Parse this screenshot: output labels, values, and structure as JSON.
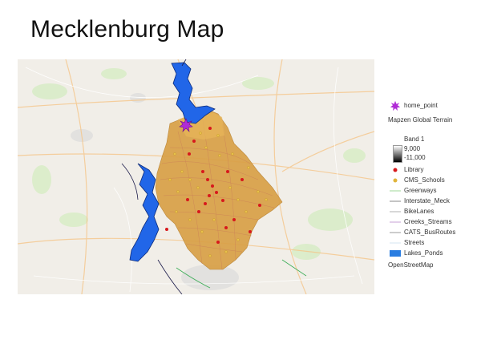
{
  "title": "Mecklenburg Map",
  "map": {
    "colors": {
      "county_fill": "#d9a047",
      "water": "#2166e8",
      "library": "#d7191c",
      "school": "#e0b43a",
      "home": "#9c27b0",
      "basemap": "#f2efe9"
    }
  },
  "legend": {
    "items": [
      {
        "key": "home_point",
        "label": "home_point",
        "symbol": "star",
        "color": "#b02bd6"
      },
      {
        "key": "terrain",
        "label": "Mapzen Global Terrain",
        "symbol": "none"
      },
      {
        "key": "band",
        "label": "Band 1",
        "symbol": "none"
      },
      {
        "key": "band_max",
        "label": "9,000",
        "symbol": "none"
      },
      {
        "key": "band_min",
        "label": "-11,000",
        "symbol": "none"
      },
      {
        "key": "library",
        "label": "Library",
        "symbol": "dot",
        "color": "#d7191c"
      },
      {
        "key": "schools",
        "label": "CMS_Schools",
        "symbol": "dot",
        "color": "#e0b43a"
      },
      {
        "key": "greenways",
        "label": "Greenways",
        "symbol": "line",
        "color": "#9fd89a"
      },
      {
        "key": "interstate",
        "label": "Interstate_Meck",
        "symbol": "line",
        "color": "#8a8a8a"
      },
      {
        "key": "bikelanes",
        "label": "BikeLanes",
        "symbol": "line",
        "color": "#b0b0b0"
      },
      {
        "key": "creeks",
        "label": "Creeks_Streams",
        "symbol": "line",
        "color": "#c7a0d6"
      },
      {
        "key": "busroutes",
        "label": "CATS_BusRoutes",
        "symbol": "line",
        "color": "#9a9a9a"
      },
      {
        "key": "streets",
        "label": "Streets",
        "symbol": "line",
        "color": "#d6e4f0"
      },
      {
        "key": "lakes",
        "label": "Lakes_Ponds",
        "symbol": "rect",
        "color": "#2a7de1"
      },
      {
        "key": "osm",
        "label": "OpenStreetMap",
        "symbol": "none"
      }
    ]
  }
}
